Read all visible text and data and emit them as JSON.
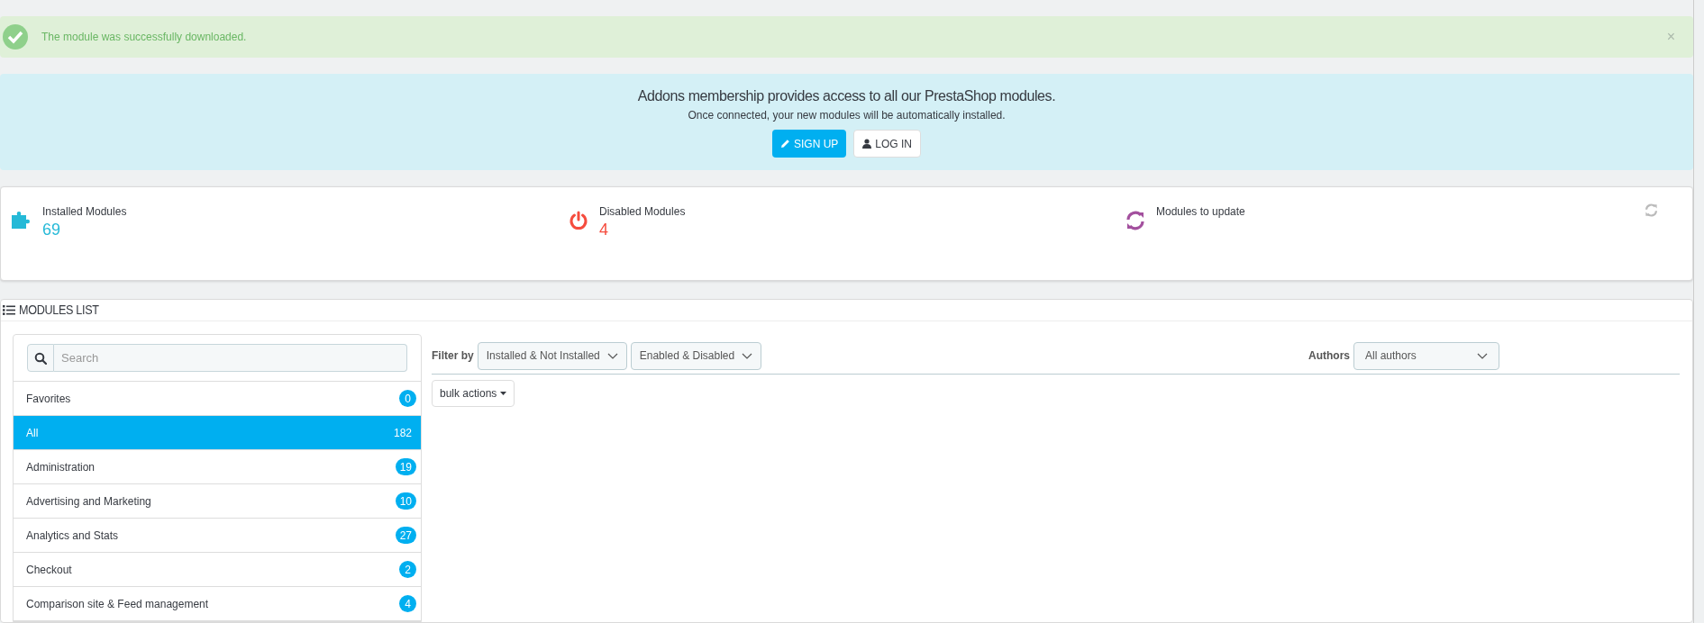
{
  "alert": {
    "message": "The module was successfully downloaded.",
    "close": "×"
  },
  "banner": {
    "title": "Addons membership provides access to all our PrestaShop modules.",
    "subtitle": "Once connected, your new modules will be automatically installed.",
    "buttons": [
      {
        "label": "SIGN UP",
        "kind": "primary"
      },
      {
        "label": "LOG IN",
        "kind": "default"
      }
    ]
  },
  "stats": [
    {
      "kind": "installed",
      "label": "Installed Modules",
      "value": "69",
      "color": "#25b9d7"
    },
    {
      "kind": "disabled",
      "label": "Disabled Modules",
      "value": "4",
      "color": "#f54c3e"
    },
    {
      "kind": "update",
      "label": "Modules to update"
    }
  ],
  "modules_list": {
    "title": "MODULES LIST",
    "search": {
      "placeholder": "Search"
    },
    "categories": [
      {
        "label": "Favorites",
        "count": "0",
        "selected": false
      },
      {
        "label": "All",
        "count": "182",
        "selected": true
      },
      {
        "label": "Administration",
        "count": "19",
        "selected": false
      },
      {
        "label": "Advertising and Marketing",
        "count": "10",
        "selected": false
      },
      {
        "label": "Analytics and Stats",
        "count": "27",
        "selected": false
      },
      {
        "label": "Checkout",
        "count": "2",
        "selected": false
      },
      {
        "label": "Comparison site & Feed management",
        "count": "4",
        "selected": false
      }
    ],
    "filter_label": "Filter by",
    "filters": [
      "Installed & Not Installed",
      "Enabled & Disabled"
    ],
    "authors_label": "Authors",
    "authors_value": "All authors",
    "bulk_actions": "bulk actions"
  }
}
